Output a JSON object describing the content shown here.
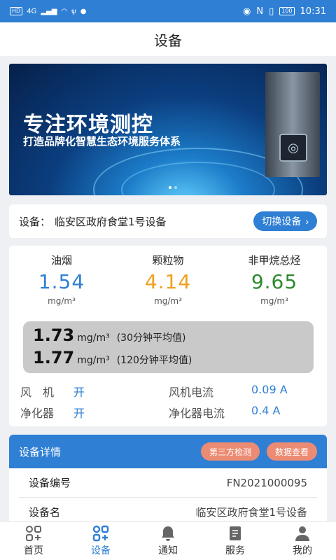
{
  "status_bar": {
    "left_icons": [
      "HD",
      "4G",
      "signal",
      "wifi",
      "usb",
      "shield"
    ],
    "network": "4G",
    "battery": "100",
    "time": "10:31"
  },
  "title": "设备",
  "banner": {
    "headline": "专注环境测控",
    "subline": "打造品牌化智慧生态环境服务体系",
    "slide_count": 2,
    "active_slide": 1
  },
  "device": {
    "label": "设备：",
    "name": "临安区政府食堂1号设备",
    "switch_label": "切换设备"
  },
  "metrics": [
    {
      "name": "油烟",
      "value": "1.54",
      "unit": "mg/m³",
      "color": "#2f7fd4"
    },
    {
      "name": "颗粒物",
      "value": "4.14",
      "unit": "mg/m³",
      "color": "#f0a01e"
    },
    {
      "name": "非甲烷总烃",
      "value": "9.65",
      "unit": "mg/m³",
      "color": "#2e8b2e"
    }
  ],
  "averages": [
    {
      "value": "1.73",
      "unit": "mg/m³",
      "note": "(30分钟平均值)"
    },
    {
      "value": "1.77",
      "unit": "mg/m³",
      "note": "(120分钟平均值)"
    }
  ],
  "states": [
    {
      "k1": "风　机",
      "v1": "开",
      "k2": "风机电流",
      "v2": "0.09 A"
    },
    {
      "k1": "净化器",
      "v1": "开",
      "k2": "净化器电流",
      "v2": "0.4 A"
    }
  ],
  "details": {
    "title": "设备详情",
    "btn_third_party": "第三方检测",
    "btn_data": "数据查看",
    "rows": [
      {
        "label": "设备编号",
        "value": "FN2021000095"
      },
      {
        "label": "设备名",
        "value": "临安区政府食堂1号设备"
      }
    ]
  },
  "nav": [
    {
      "label": "首页",
      "icon": "home-grid-icon"
    },
    {
      "label": "设备",
      "icon": "device-grid-icon",
      "active": true
    },
    {
      "label": "通知",
      "icon": "bell-icon"
    },
    {
      "label": "服务",
      "icon": "document-icon"
    },
    {
      "label": "我的",
      "icon": "person-icon"
    }
  ],
  "colors": {
    "primary": "#2f7fd4",
    "accent_pill": "#ec8b73",
    "avg_box": "#c9c9c9"
  }
}
